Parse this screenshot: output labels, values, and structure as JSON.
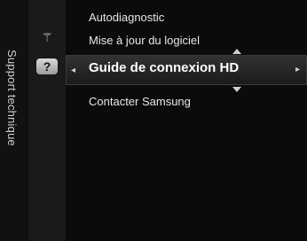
{
  "side": {
    "title": "Support technique"
  },
  "icons": [
    {
      "name": "self-diagnosis-icon",
      "glyph": "⚚"
    },
    {
      "name": "question-icon",
      "glyph": "?"
    }
  ],
  "menu": {
    "items": [
      {
        "label": "Autodiagnostic"
      },
      {
        "label": "Mise à jour du logiciel"
      },
      {
        "label": "Guide de connexion HD",
        "selected": true
      },
      {
        "label": "Contacter Samsung"
      }
    ]
  },
  "ui": {
    "left_caret": "◂",
    "right_caret": "▸"
  }
}
